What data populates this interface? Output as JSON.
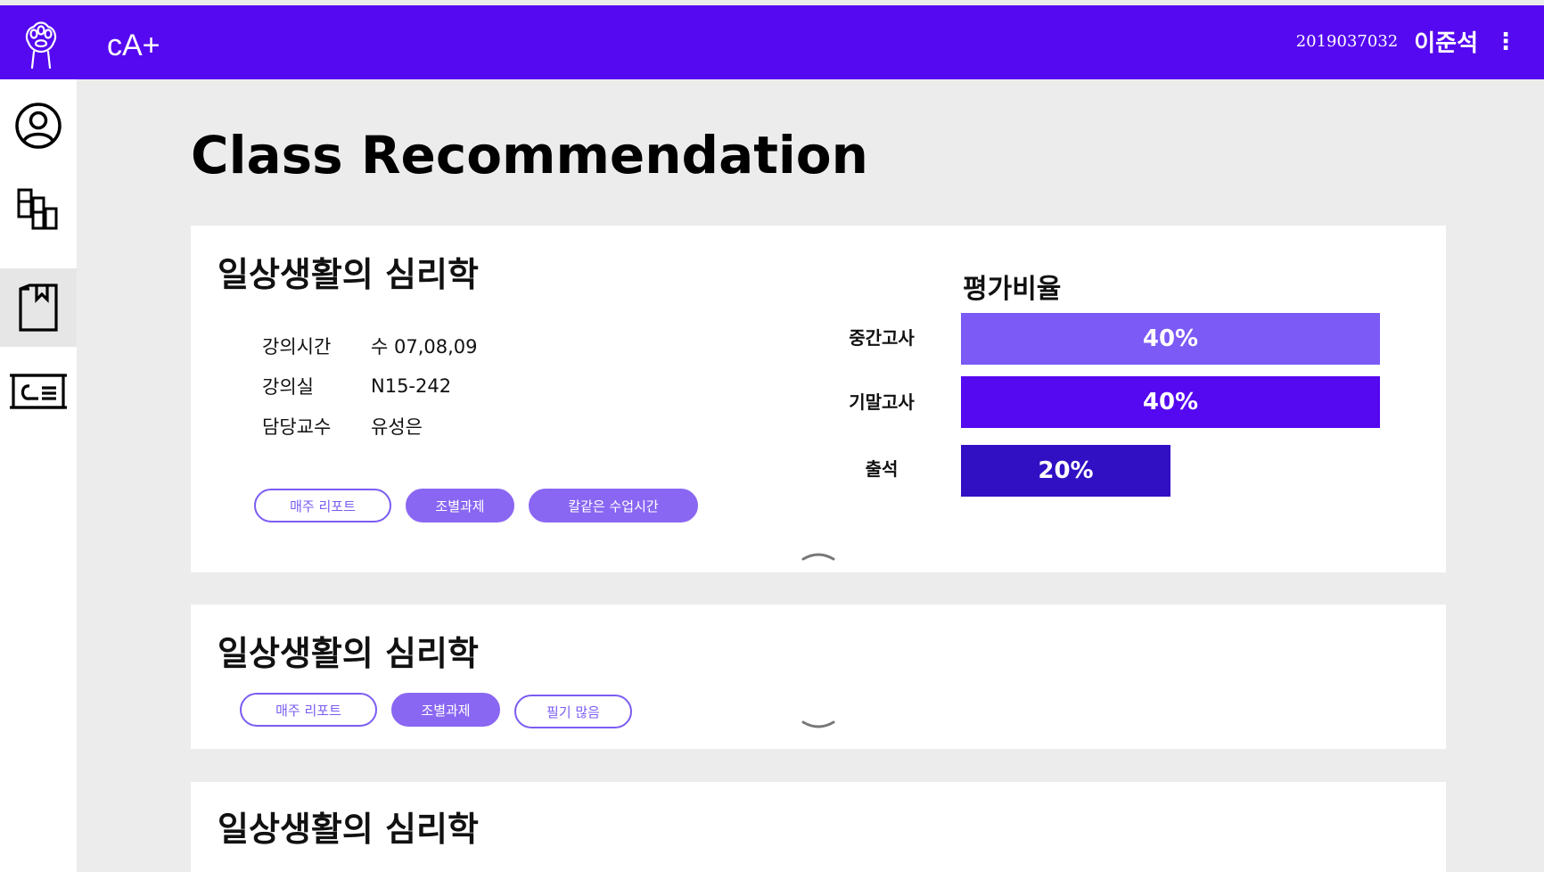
{
  "header": {
    "app_name": "cA+",
    "user_id": "2019037032",
    "user_name": "이준석",
    "menu_icon": "kebab-menu-icon",
    "logo_icon": "paw-logo-icon",
    "bg_color": "#5509f0"
  },
  "sidebar": {
    "items": [
      {
        "icon": "profile-icon",
        "active": false
      },
      {
        "icon": "dashboard-icon",
        "active": false
      },
      {
        "icon": "bookmark-book-icon",
        "active": true
      },
      {
        "icon": "presentation-icon",
        "active": false
      }
    ]
  },
  "page": {
    "title": "Class Recommendation"
  },
  "courses": [
    {
      "title": "일상생활의 심리학",
      "expanded": true,
      "info": [
        {
          "label": "강의시간",
          "value": "수 07,08,09"
        },
        {
          "label": "강의실",
          "value": "N15-242"
        },
        {
          "label": "담당교수",
          "value": "유성은"
        }
      ],
      "tags": [
        {
          "label": "매주 리포트",
          "filled": false
        },
        {
          "label": "조별과제",
          "filled": true
        },
        {
          "label": "칼같은 수업시간",
          "filled": true
        }
      ],
      "evaluation": {
        "title": "평가비율",
        "items": [
          {
            "label": "중간고사",
            "value": "40%",
            "ratio": 0.4,
            "color": "#7b5af5"
          },
          {
            "label": "기말고사",
            "value": "40%",
            "ratio": 0.4,
            "color": "#5509f0"
          },
          {
            "label": "출석",
            "value": "20%",
            "ratio": 0.2,
            "color": "#3110c4"
          }
        ]
      },
      "toggle_icon": "chevron-up-icon"
    },
    {
      "title": "일상생활의 심리학",
      "expanded": false,
      "tags": [
        {
          "label": "매주 리포트",
          "filled": false
        },
        {
          "label": "조별과제",
          "filled": true
        },
        {
          "label": "필기 많음",
          "filled": false
        }
      ],
      "toggle_icon": "chevron-down-icon"
    },
    {
      "title": "일상생활의 심리학",
      "expanded": false
    }
  ]
}
